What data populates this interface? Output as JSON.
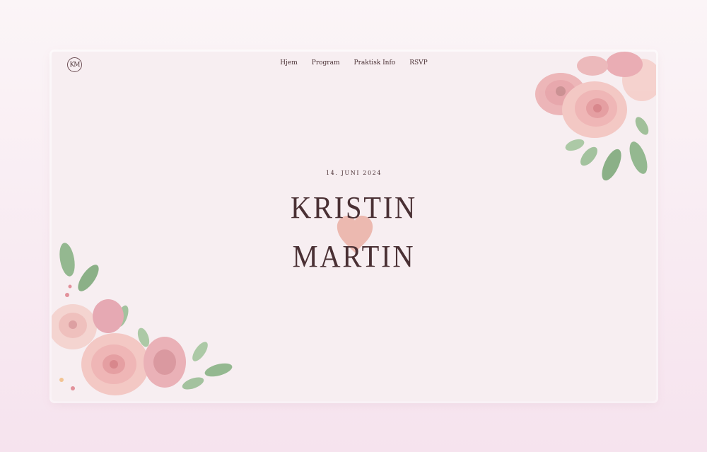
{
  "logo": {
    "monogram": "KM"
  },
  "nav": {
    "items": [
      {
        "label": "Hjem"
      },
      {
        "label": "Program"
      },
      {
        "label": "Praktisk Info"
      },
      {
        "label": "RSVP"
      }
    ]
  },
  "hero": {
    "date": "14. JUNI 2024",
    "name_first": "KRISTIN",
    "name_second": "MARTIN"
  },
  "colors": {
    "page_bg_top": "#fbf5f7",
    "page_bg_bottom": "#f6e3ee",
    "card_bg": "#f7eef1",
    "text": "#4a3034",
    "heart": "#eab3a8",
    "rose": "#eeb5bb",
    "leaf": "#8fb68b"
  },
  "icons": {
    "logo": "monogram-circle-icon",
    "heart": "heart-icon",
    "floral_top": "rose-bouquet-icon",
    "floral_bottom": "rose-bouquet-icon"
  }
}
